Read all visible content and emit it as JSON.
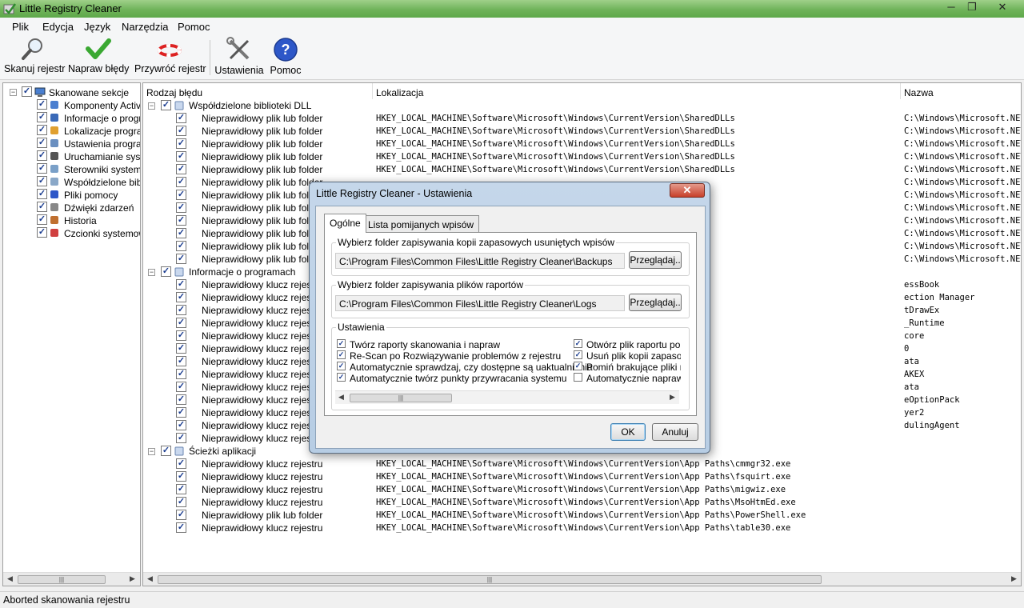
{
  "window": {
    "title": "Little Registry Cleaner"
  },
  "menu": [
    "Plik",
    "Edycja",
    "Język",
    "Narzędzia",
    "Pomoc"
  ],
  "toolbar": {
    "scan": "Skanuj rejestr",
    "fix": "Napraw błędy",
    "restore": "Przywróć rejestr",
    "settings": "Ustawienia",
    "help": "Pomoc"
  },
  "tree": {
    "root": "Skanowane sekcje",
    "items": [
      {
        "label": "Komponenty ActiveX",
        "icon": "activex-icon"
      },
      {
        "label": "Informacje o programach",
        "icon": "program-info-icon"
      },
      {
        "label": "Lokalizacje programów",
        "icon": "folder-icon"
      },
      {
        "label": "Ustawienia programów",
        "icon": "program-settings-icon"
      },
      {
        "label": "Uruchamianie systemu",
        "icon": "startup-icon"
      },
      {
        "label": "Sterowniki systemowe",
        "icon": "driver-icon"
      },
      {
        "label": "Współdzielone biblioteki DLL",
        "icon": "dll-icon"
      },
      {
        "label": "Pliki pomocy",
        "icon": "help-icon"
      },
      {
        "label": "Dźwięki zdarzeń",
        "icon": "sound-icon"
      },
      {
        "label": "Historia",
        "icon": "history-icon"
      },
      {
        "label": "Czcionki systemowe",
        "icon": "font-icon"
      }
    ]
  },
  "columns": {
    "type": "Rodzaj błędu",
    "location": "Lokalizacja",
    "name": "Nazwa"
  },
  "groups": [
    {
      "label": "Współdzielone biblioteki DLL",
      "rows": [
        {
          "type": "Nieprawidłowy plik lub folder",
          "location": "HKEY_LOCAL_MACHINE\\Software\\Microsoft\\Windows\\CurrentVersion\\SharedDLLs",
          "name": "C:\\Windows\\Microsoft.NET\\Fra"
        },
        {
          "type": "Nieprawidłowy plik lub folder",
          "location": "HKEY_LOCAL_MACHINE\\Software\\Microsoft\\Windows\\CurrentVersion\\SharedDLLs",
          "name": "C:\\Windows\\Microsoft.NET\\Fra"
        },
        {
          "type": "Nieprawidłowy plik lub folder",
          "location": "HKEY_LOCAL_MACHINE\\Software\\Microsoft\\Windows\\CurrentVersion\\SharedDLLs",
          "name": "C:\\Windows\\Microsoft.NET\\Fra"
        },
        {
          "type": "Nieprawidłowy plik lub folder",
          "location": "HKEY_LOCAL_MACHINE\\Software\\Microsoft\\Windows\\CurrentVersion\\SharedDLLs",
          "name": "C:\\Windows\\Microsoft.NET\\Fra"
        },
        {
          "type": "Nieprawidłowy plik lub folder",
          "location": "HKEY_LOCAL_MACHINE\\Software\\Microsoft\\Windows\\CurrentVersion\\SharedDLLs",
          "name": "C:\\Windows\\Microsoft.NET\\Fra"
        },
        {
          "type": "Nieprawidłowy plik lub folder",
          "location": "",
          "name": "C:\\Windows\\Microsoft.NET\\Fra"
        },
        {
          "type": "Nieprawidłowy plik lub folder",
          "location": "",
          "name": "C:\\Windows\\Microsoft.NET\\Fra"
        },
        {
          "type": "Nieprawidłowy plik lub folder",
          "location": "",
          "name": "C:\\Windows\\Microsoft.NET\\Fra"
        },
        {
          "type": "Nieprawidłowy plik lub folder",
          "location": "",
          "name": "C:\\Windows\\Microsoft.NET\\Fra"
        },
        {
          "type": "Nieprawidłowy plik lub folder",
          "location": "",
          "name": "C:\\Windows\\Microsoft.NET\\Fra"
        },
        {
          "type": "Nieprawidłowy plik lub folder",
          "location": "",
          "name": "C:\\Windows\\Microsoft.NET\\Fra"
        },
        {
          "type": "Nieprawidłowy plik lub folder",
          "location": "",
          "name": "C:\\Windows\\Microsoft.NET\\Fra"
        }
      ]
    },
    {
      "label": "Informacje o programach",
      "rows": [
        {
          "type": "Nieprawidłowy klucz rejestru",
          "location": "",
          "name": "essBook"
        },
        {
          "type": "Nieprawidłowy klucz rejestru",
          "location": "",
          "name": "ection Manager"
        },
        {
          "type": "Nieprawidłowy klucz rejestru",
          "location": "",
          "name": "tDrawEx"
        },
        {
          "type": "Nieprawidłowy klucz rejestru",
          "location": "",
          "name": "_Runtime"
        },
        {
          "type": "Nieprawidłowy klucz rejestru",
          "location": "",
          "name": "core"
        },
        {
          "type": "Nieprawidłowy klucz rejestru",
          "location": "",
          "name": "0"
        },
        {
          "type": "Nieprawidłowy klucz rejestru",
          "location": "",
          "name": "ata"
        },
        {
          "type": "Nieprawidłowy klucz rejestru",
          "location": "",
          "name": "AKEX"
        },
        {
          "type": "Nieprawidłowy klucz rejestru",
          "location": "",
          "name": "ata"
        },
        {
          "type": "Nieprawidłowy klucz rejestru",
          "location": "",
          "name": "eOptionPack"
        },
        {
          "type": "Nieprawidłowy klucz rejestru",
          "location": "",
          "name": "yer2"
        },
        {
          "type": "Nieprawidłowy klucz rejestru",
          "location": "",
          "name": "dulingAgent"
        },
        {
          "type": "Nieprawidłowy klucz rejestru",
          "location": "",
          "name": ""
        }
      ]
    },
    {
      "label": "Ścieżki aplikacji",
      "rows": [
        {
          "type": "Nieprawidłowy klucz rejestru",
          "location": "HKEY_LOCAL_MACHINE\\Software\\Microsoft\\Windows\\CurrentVersion\\App Paths\\cmmgr32.exe",
          "name": ""
        },
        {
          "type": "Nieprawidłowy klucz rejestru",
          "location": "HKEY_LOCAL_MACHINE\\Software\\Microsoft\\Windows\\CurrentVersion\\App Paths\\fsquirt.exe",
          "name": ""
        },
        {
          "type": "Nieprawidłowy klucz rejestru",
          "location": "HKEY_LOCAL_MACHINE\\Software\\Microsoft\\Windows\\CurrentVersion\\App Paths\\migwiz.exe",
          "name": ""
        },
        {
          "type": "Nieprawidłowy klucz rejestru",
          "location": "HKEY_LOCAL_MACHINE\\Software\\Microsoft\\Windows\\CurrentVersion\\App Paths\\MsoHtmEd.exe",
          "name": ""
        },
        {
          "type": "Nieprawidłowy plik lub folder",
          "location": "HKEY_LOCAL_MACHINE\\Software\\Microsoft\\Windows\\CurrentVersion\\App Paths\\PowerShell.exe",
          "name": ""
        },
        {
          "type": "Nieprawidłowy klucz rejestru",
          "location": "HKEY_LOCAL_MACHINE\\Software\\Microsoft\\Windows\\CurrentVersion\\App Paths\\table30.exe",
          "name": ""
        }
      ]
    }
  ],
  "status": "Aborted skanowania rejestru",
  "dialog": {
    "title": "Little Registry Cleaner - Ustawienia",
    "close": "✕",
    "tabs": [
      "Ogólne",
      "Lista pomijanych wpisów"
    ],
    "backup_group": "Wybierz folder zapisywania kopii zapasowych usuniętych wpisów",
    "backup_path": "C:\\Program Files\\Common Files\\Little Registry Cleaner\\Backups",
    "log_group": "Wybierz folder zapisywania plików raportów",
    "log_path": "C:\\Program Files\\Common Files\\Little Registry Cleaner\\Logs",
    "browse": "Przeglądaj..",
    "settings_group": "Ustawienia",
    "options_left": [
      {
        "label": "Twórz raporty skanowania i napraw",
        "checked": true
      },
      {
        "label": "Re-Scan po Rozwiązywanie problemów z rejestru",
        "checked": true
      },
      {
        "label": "Automatycznie sprawdzaj, czy dostępne są uaktualnienia",
        "checked": true
      },
      {
        "label": "Automatycznie twórz punkty przywracania systemu",
        "checked": true
      }
    ],
    "options_right": [
      {
        "label": "Otwórz plik raportu po za",
        "checked": true
      },
      {
        "label": "Usuń plik kopii zapasow",
        "checked": true
      },
      {
        "label": "Pomiń brakujące pliki na",
        "checked": true
      },
      {
        "label": "Automatycznie napraw e",
        "checked": false
      }
    ],
    "ok": "OK",
    "cancel": "Anuluj"
  },
  "colors": {
    "title_green": "#6fb35a",
    "dialog_frame": "#b7cde4",
    "check_blue": "#1a3c8f"
  }
}
